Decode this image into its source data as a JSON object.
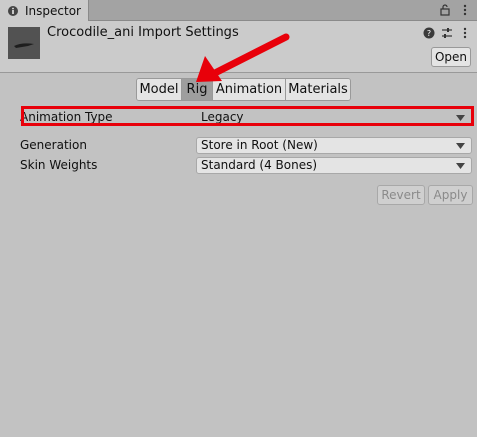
{
  "window": {
    "tab_label": "Inspector"
  },
  "header": {
    "title": "Crocodile_ani Import Settings",
    "open_label": "Open"
  },
  "tabs": [
    "Model",
    "Rig",
    "Animation",
    "Materials"
  ],
  "active_tab": "Rig",
  "fields": [
    {
      "label": "Animation Type",
      "value": "Legacy"
    },
    {
      "label": "Generation",
      "value": "Store in Root (New)"
    },
    {
      "label": "Skin Weights",
      "value": "Standard (4 Bones)"
    }
  ],
  "buttons": {
    "revert": "Revert",
    "apply": "Apply"
  },
  "annotation": {
    "highlight_color": "#e8000a"
  },
  "icons": [
    "inspector-icon",
    "lock-icon",
    "menu-icon",
    "help-icon",
    "preset-icon",
    "more-icon",
    "model-thumbnail",
    "dropdown-arrow-icon"
  ]
}
